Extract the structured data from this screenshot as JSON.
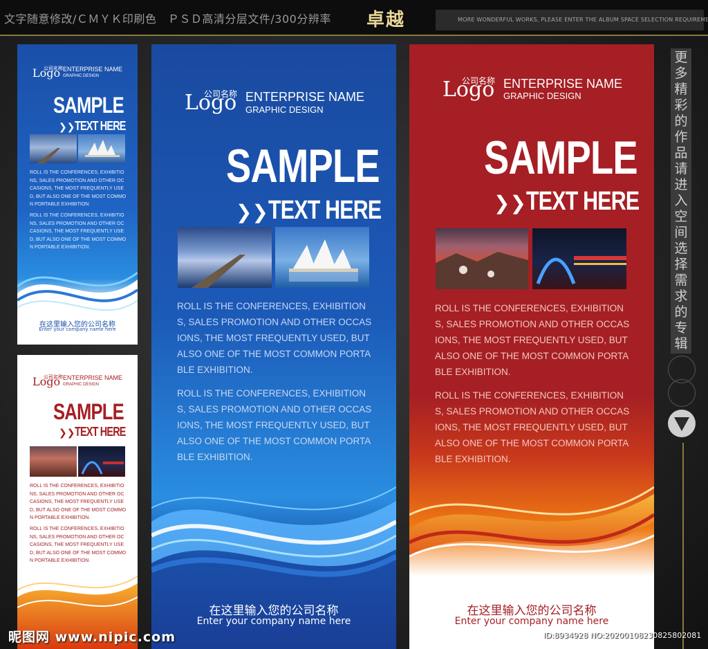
{
  "header": {
    "left_text": "文字随意修改/ＣＭＹＫ印刷色　ＰＳＤ高清分层文件/300分辨率",
    "center_title": "卓越",
    "right_text": "MORE WONDERFUL WORKS, PLEASE ENTER THE ALBUM SPACE SELECTION REQUIREMENTS"
  },
  "banner": {
    "logo_cn": "公司名称",
    "logo_word": "Logo",
    "enterprise_name": "ENTERPRISE NAME",
    "graphic_design": "GRAPHIC DESIGN",
    "sample": "SAMPLE",
    "text_here": "TEXT HERE",
    "chevrons": "❯❯",
    "paragraph_1": "ROLL IS THE CONFERENCES, EXHIBITIONS, SALES PROMOTION AND OTHER OCCASIONS, THE MOST FREQUENTLY USED, BUT ALSO ONE OF THE MOST COMMON PORTABLE EXHIBITION.",
    "paragraph_2": "ROLL IS THE CONFERENCES, EXHIBITIONS, SALES PROMOTION AND OTHER OCCASIONS, THE MOST FREQUENTLY USED, BUT ALSO ONE OF THE MOST COMMON PORTABLE EXHIBITION.",
    "company_cn": "在这里输入您的公司名称",
    "company_en": "Enter your company name here"
  },
  "sidebar": {
    "vertical_text": [
      "更",
      "多",
      "精",
      "彩",
      "的",
      "作",
      "品",
      "请",
      "进",
      "入",
      "空",
      "间",
      "选",
      "择",
      "需",
      "求",
      "的",
      "专",
      "辑"
    ],
    "next_icon": "triangle-down-icon"
  },
  "watermark": {
    "left": "昵图网 www.nipic.com",
    "right": "ID:8934928 NO:20200108230825802081"
  },
  "colors": {
    "blue": "#1a4fa8",
    "red": "#a51f24",
    "orange": "#f07a12",
    "white": "#ffffff",
    "gold": "#e8d69a"
  }
}
